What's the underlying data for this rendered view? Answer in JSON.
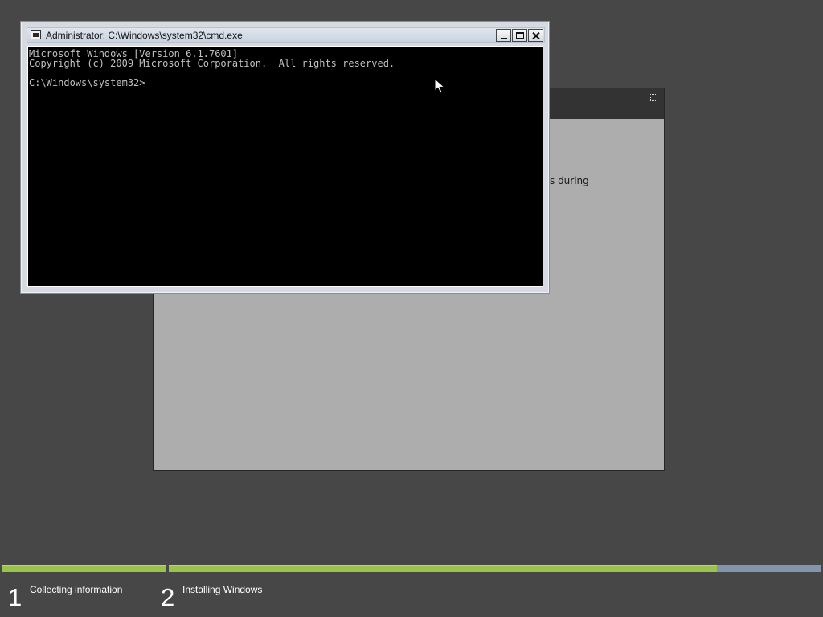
{
  "setup_dialog": {
    "partial_text": "s during"
  },
  "cmd_window": {
    "title": "Administrator: C:\\Windows\\system32\\cmd.exe",
    "icon": "console-icon",
    "controls": {
      "minimize_icon": "minimize-icon",
      "maximize_icon": "maximize-icon",
      "close_icon": "close-icon"
    },
    "console_lines": [
      "Microsoft Windows [Version 6.1.7601]",
      "Copyright (c) 2009 Microsoft Corporation.  All rights reserved.",
      "",
      "C:\\Windows\\system32>"
    ]
  },
  "progress": {
    "steps": [
      {
        "number": "1",
        "label": "Collecting information",
        "progress_fraction": 1.0
      },
      {
        "number": "2",
        "label": "Installing Windows",
        "progress_fraction": 0.84
      }
    ],
    "colors": {
      "complete": "#9bc24a",
      "remaining": "#8394ad"
    }
  }
}
